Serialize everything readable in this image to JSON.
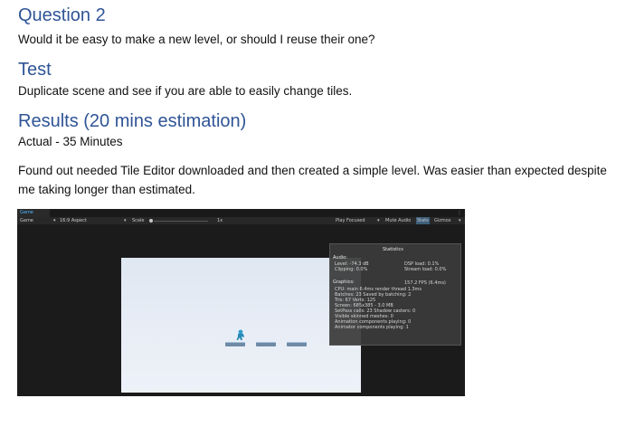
{
  "doc": {
    "q_heading": "Question 2",
    "q_text": "Would it be easy to make a new level, or should I reuse their one?",
    "test_heading": "Test",
    "test_text": "Duplicate scene and see if you are able to easily change tiles.",
    "results_heading": "Results (20 mins estimation)",
    "actual_text": "Actual - 35 Minutes",
    "paragraph": "Found out needed Tile Editor downloaded and then created a simple level. Was easier than expected despite me taking longer than estimated."
  },
  "unity": {
    "tab_label": "Game",
    "toolbar": {
      "game_label": "Game",
      "aspect": "16:9 Aspect",
      "scale_label": "Scale",
      "scale_value": "1x",
      "play_focused": "Play Focused",
      "mute_audio": "Mute Audio",
      "stats": "Stats",
      "gizmos": "Gizmos"
    },
    "stats": {
      "title": "Statistics",
      "audio_header": "Audio:",
      "level": "Level: -74.3 dB",
      "clipping": "Clipping: 0.0%",
      "dsp_load": "DSP load: 0.1%",
      "stream_load": "Stream load: 0.0%",
      "graphics_header": "Graphics:",
      "fps": "157.2 FPS (6.4ms)",
      "cpu": "CPU: main 6.4ms  render thread 1.3ms",
      "batches": "Batches: 23    Saved by batching: 2",
      "tris": "Tris: 67              Verts: 125",
      "screen": "Screen: 685x385 - 3.0 MB",
      "setpass": "SetPass calls: 23         Shadow casters: 0",
      "skinned": "Visible skinned meshes: 0",
      "anim": "Animation components playing: 0",
      "animator": "Animator components playing: 1"
    },
    "colors": {
      "accent": "#4fb6ff",
      "panel": "#3a3a3a",
      "game_bg": "#e6ecf5"
    }
  }
}
